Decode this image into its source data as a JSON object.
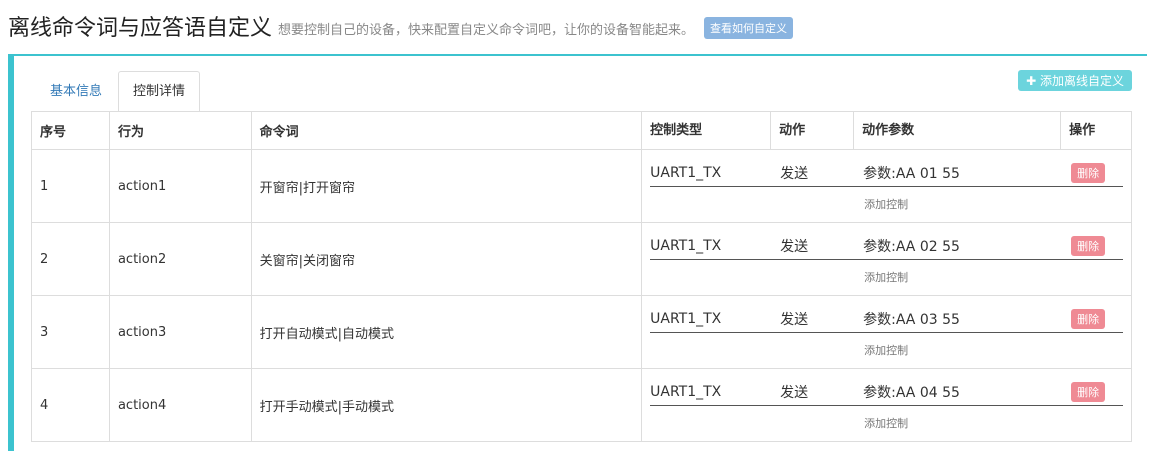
{
  "header": {
    "title": "离线命令词与应答语自定义",
    "subtitle": "想要控制自己的设备，快来配置自定义命令词吧，让你的设备智能起来。",
    "howto_label": "查看如何自定义"
  },
  "tabs": [
    {
      "label": "基本信息",
      "active": false
    },
    {
      "label": "控制详情",
      "active": true
    }
  ],
  "add_button_label": "✚ 添加离线自定义",
  "table": {
    "headers": {
      "index": "序号",
      "behavior": "行为",
      "command": "命令词",
      "control_type": "控制类型",
      "action": "动作",
      "action_param": "动作参数",
      "operation": "操作"
    },
    "rows": [
      {
        "index": "1",
        "behavior": "action1",
        "command": "开窗帘|打开窗帘",
        "control_type": "UART1_TX",
        "action": "发送",
        "param": "参数:AA 01 55",
        "delete": "删除",
        "add_control": "添加控制"
      },
      {
        "index": "2",
        "behavior": "action2",
        "command": "关窗帘|关闭窗帘",
        "control_type": "UART1_TX",
        "action": "发送",
        "param": "参数:AA 02 55",
        "delete": "删除",
        "add_control": "添加控制"
      },
      {
        "index": "3",
        "behavior": "action3",
        "command": "打开自动模式|自动模式",
        "control_type": "UART1_TX",
        "action": "发送",
        "param": "参数:AA 03 55",
        "delete": "删除",
        "add_control": "添加控制"
      },
      {
        "index": "4",
        "behavior": "action4",
        "command": "打开手动模式|手动模式",
        "control_type": "UART1_TX",
        "action": "发送",
        "param": "参数:AA 04 55",
        "delete": "删除",
        "add_control": "添加控制"
      }
    ]
  },
  "colors": {
    "accent": "#3cc3cf",
    "delete": "#ef8a94",
    "howto": "#8ab4e0",
    "add": "#6cd4dd"
  }
}
